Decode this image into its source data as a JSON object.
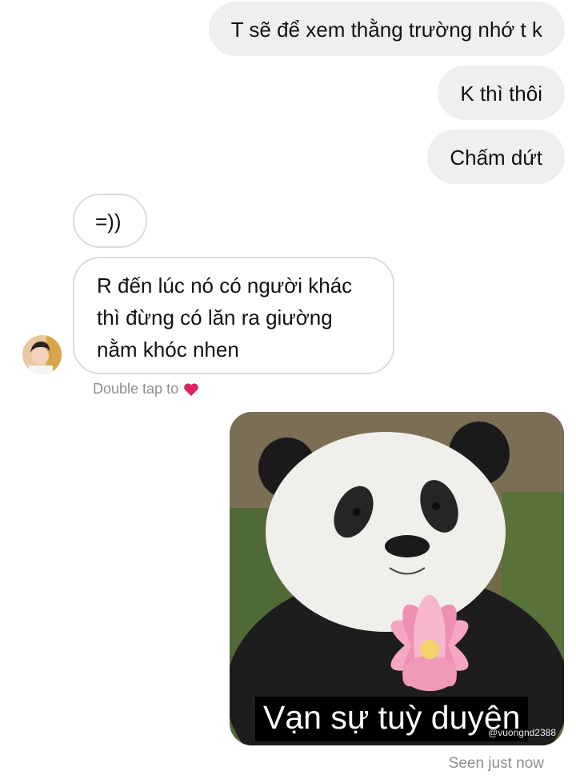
{
  "messages": {
    "sent": [
      "T sẽ để xem thằng trường nhớ t k",
      "K thì thôi",
      "Chấm dứt"
    ],
    "received": [
      "=))",
      "R đến lúc nó có người khác thì đừng có lăn ra giường nằm khóc nhen"
    ]
  },
  "reaction_hint": "Double tap to",
  "reaction_icon": "heart-icon",
  "image": {
    "caption": "Vạn sự tuỳ duyên",
    "watermark": "@vuongnd2388"
  },
  "status": "Seen just now",
  "colors": {
    "sent_bubble": "#efefef",
    "received_border": "#dbdbdb",
    "meta_text": "#8e8e8e",
    "heart": "#e0245e"
  }
}
